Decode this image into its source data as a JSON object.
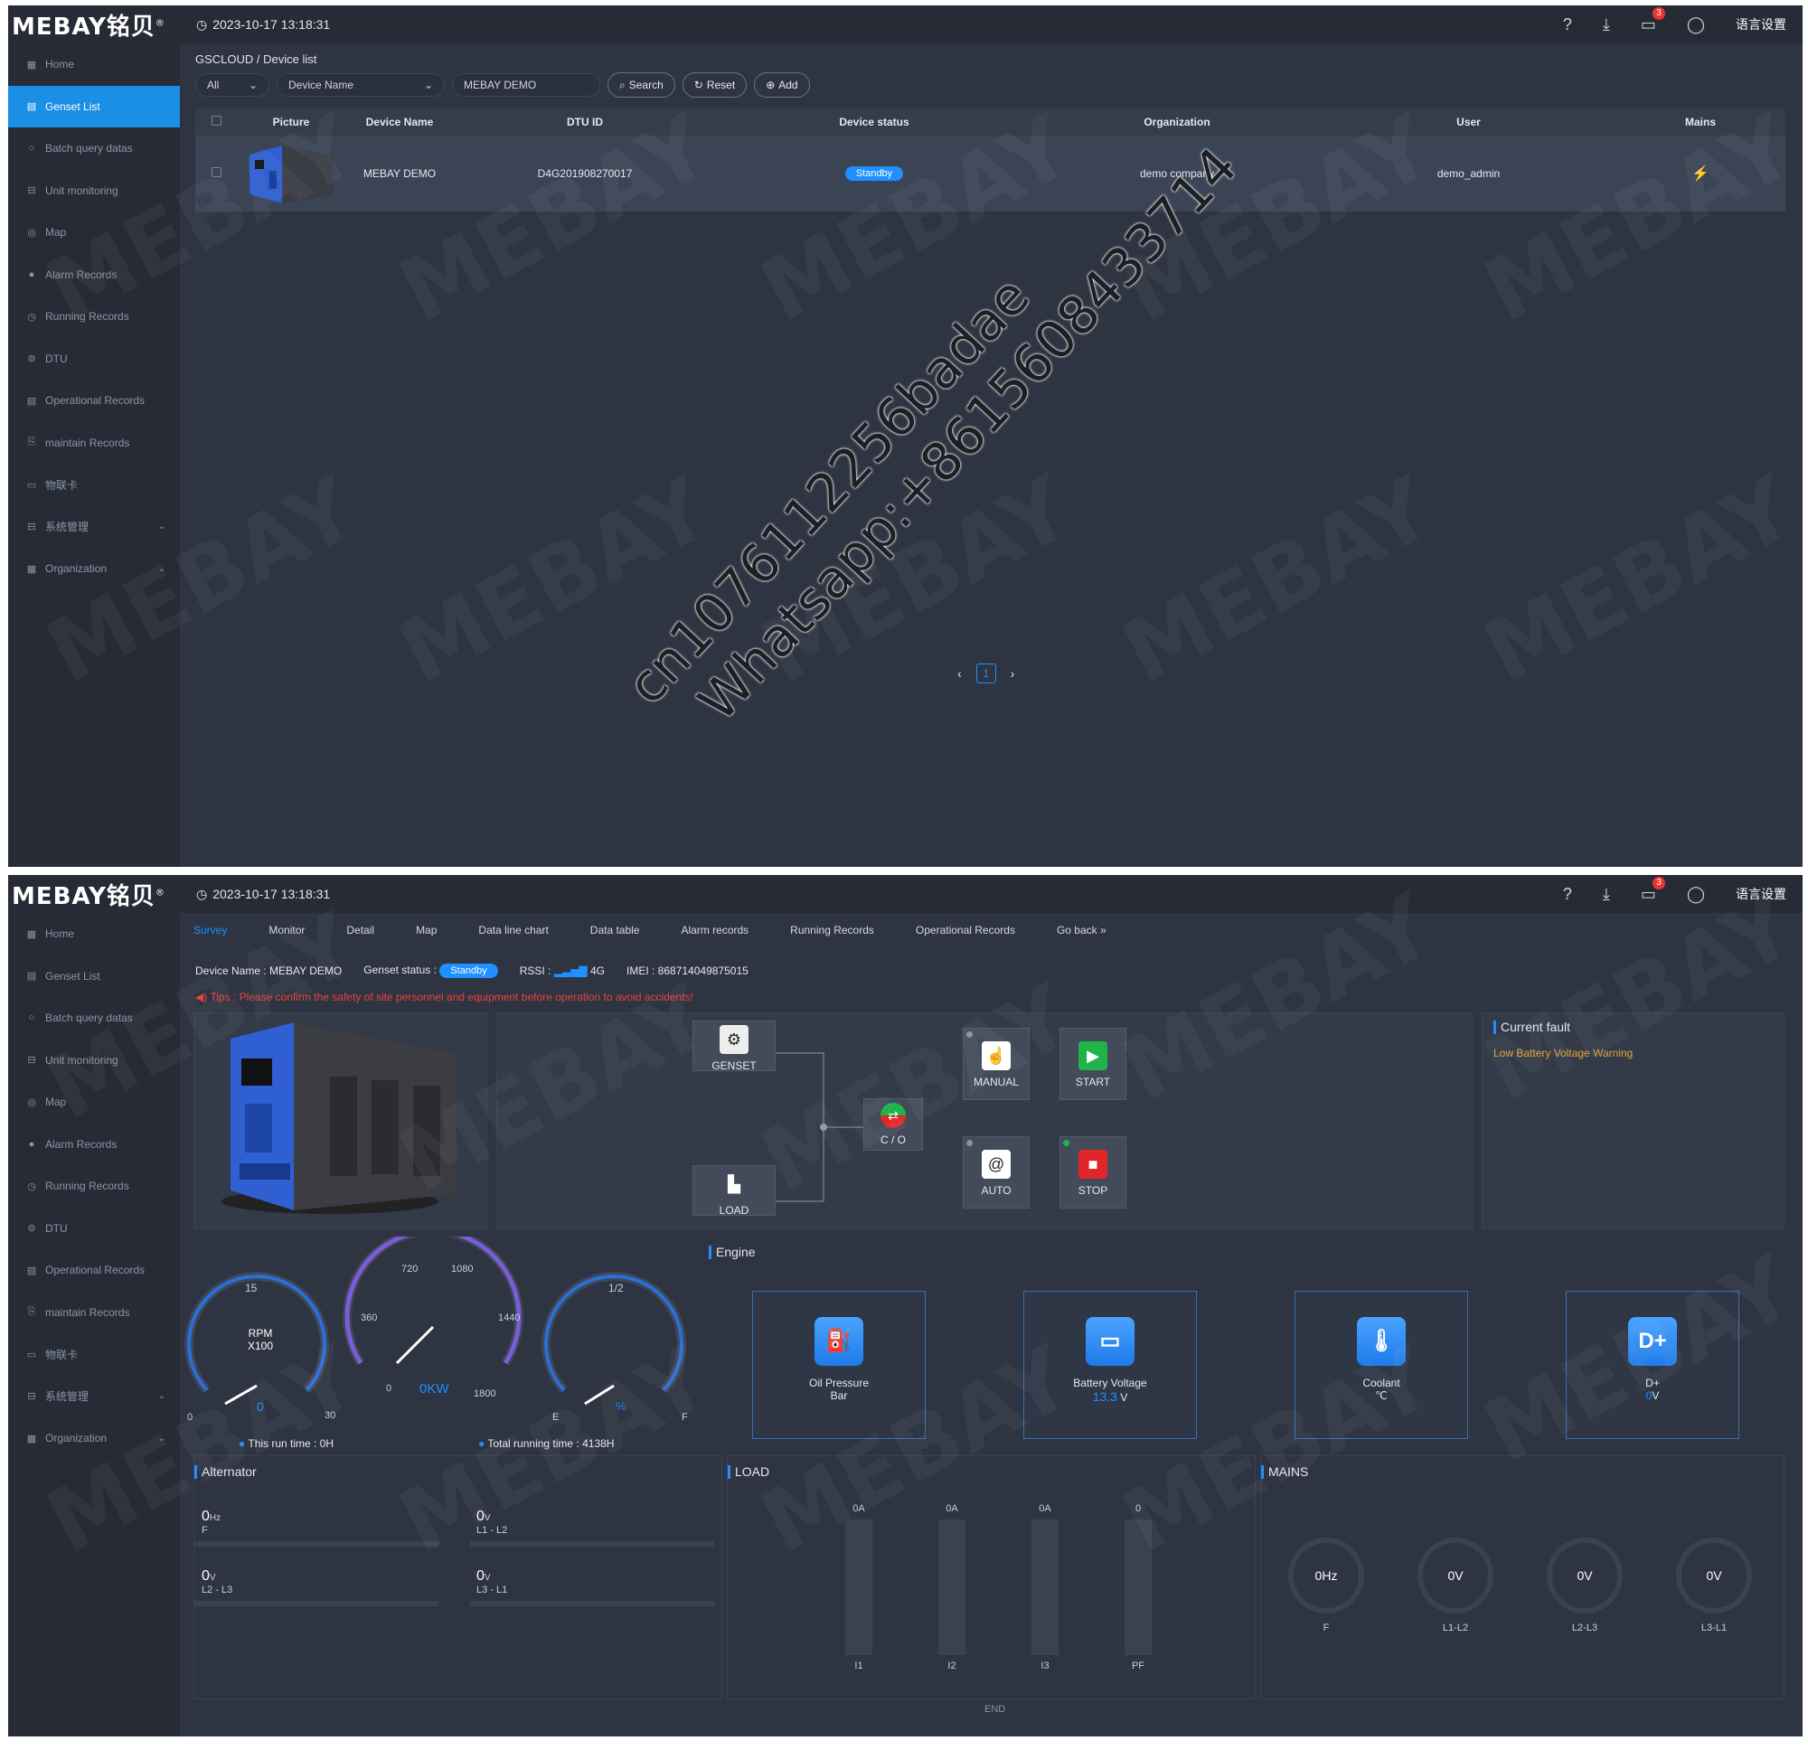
{
  "app": {
    "logo": "MEBAY铭贝",
    "logo_mark": "®",
    "datetime": "2023-10-17 13:18:31",
    "lang_label": "语言设置",
    "msg_count": "3"
  },
  "sidebar": {
    "items": [
      {
        "label": "Home",
        "icon": "grid-icon"
      },
      {
        "label": "Genset List",
        "icon": "list-icon"
      },
      {
        "label": "Batch query datas",
        "icon": "search-icon"
      },
      {
        "label": "Unit monitoring",
        "icon": "monitor-icon"
      },
      {
        "label": "Map",
        "icon": "pin-icon"
      },
      {
        "label": "Alarm Records",
        "icon": "alarm-icon"
      },
      {
        "label": "Running Records",
        "icon": "clock-icon"
      },
      {
        "label": "DTU",
        "icon": "dtu-icon"
      },
      {
        "label": "Operational Records",
        "icon": "record-icon"
      },
      {
        "label": "maintain Records",
        "icon": "clipboard-icon"
      },
      {
        "label": "物联卡",
        "icon": "card-icon"
      },
      {
        "label": "系统管理",
        "icon": "settings-icon"
      },
      {
        "label": "Organization",
        "icon": "org-icon"
      }
    ]
  },
  "devlist": {
    "breadcrumb": "GSCLOUD / Device list",
    "filter_all": "All",
    "filter_field": "Device Name",
    "search_value": "MEBAY DEMO",
    "btn_search": "Search",
    "btn_reset": "Reset",
    "btn_add": "Add",
    "columns": [
      "Picture",
      "Device Name",
      "DTU ID",
      "Device status",
      "Organization",
      "User",
      "Mains"
    ],
    "row": {
      "device_name": "MEBAY DEMO",
      "dtu_id": "D4G201908270017",
      "status": "Standby",
      "organization": "demo company",
      "user": "demo_admin"
    },
    "page": "1"
  },
  "survey": {
    "tabs": [
      "Survey",
      "Monitor",
      "Detail",
      "Map",
      "Data line chart",
      "Data table",
      "Alarm records",
      "Running Records",
      "Operational Records",
      "Go back"
    ],
    "device_name": "Device Name : MEBAY DEMO",
    "genset_status_label": "Genset status :",
    "genset_status": "Standby",
    "rssi_label": "RSSI :",
    "rssi_value": "4G",
    "imei": "IMEI : 868714049875015",
    "tips": "Tips : Please confirm the safety of site personnel and equipment before operation to avoid accidents!",
    "diagram": {
      "genset": "GENSET",
      "load": "LOAD",
      "co": "C / O",
      "manual": "MANUAL",
      "start": "START",
      "auto": "AUTO",
      "stop": "STOP"
    },
    "current_fault_title": "Current fault",
    "current_fault": "Low Battery Voltage Warning",
    "gauges": {
      "rpm": {
        "label1": "RPM",
        "label2": "X100",
        "min": "0",
        "max": "30",
        "mid": "15",
        "value": "0"
      },
      "power": {
        "t360": "360",
        "t720": "720",
        "t1080": "1080",
        "t1440": "1440",
        "t0": "0",
        "t1800": "1800",
        "value": "0KW"
      },
      "fuel": {
        "e": "E",
        "f": "F",
        "half": "1/2",
        "value": "%"
      }
    },
    "this_run_time": "This run time : 0H",
    "total_running_time": "Total running time : 4138H",
    "engine_title": "Engine",
    "engine": [
      {
        "name": "Oil Pressure",
        "value": "",
        "unit": "Bar"
      },
      {
        "name": "Battery Voltage",
        "value": "13.3",
        "unit": "V"
      },
      {
        "name": "Coolant",
        "value": "",
        "unit": "℃"
      },
      {
        "name": "D+",
        "value": "0",
        "unit": "V"
      }
    ],
    "alternator_title": "Alternator",
    "alternator": [
      {
        "value": "0",
        "unit": "Hz",
        "label": "F"
      },
      {
        "value": "0",
        "unit": "V",
        "label": "L1 - L2"
      },
      {
        "value": "0",
        "unit": "V",
        "label": "L2 - L3"
      },
      {
        "value": "0",
        "unit": "V",
        "label": "L3 - L1"
      }
    ],
    "load_title": "LOAD",
    "load": [
      {
        "top": "0A",
        "bottom": "I1"
      },
      {
        "top": "0A",
        "bottom": "I2"
      },
      {
        "top": "0A",
        "bottom": "I3"
      },
      {
        "top": "0",
        "bottom": "PF"
      }
    ],
    "mains_title": "MAINS",
    "mains": [
      {
        "value": "0Hz",
        "label": "F"
      },
      {
        "value": "0V",
        "label": "L1-L2"
      },
      {
        "value": "0V",
        "label": "L2-L3"
      },
      {
        "value": "0V",
        "label": "L3-L1"
      }
    ],
    "end_label": "END"
  },
  "watermark": {
    "brand": "MEBAY",
    "overlay_line1": "cn1076112256badae",
    "overlay_line2": "Whatsapp:+8615608433714"
  },
  "colors": {
    "accent": "#1e90ff",
    "sidebar": "#262b35",
    "background": "#2e3441",
    "danger": "#e8453c",
    "start": "#1fb44a",
    "stop": "#e0262a"
  }
}
